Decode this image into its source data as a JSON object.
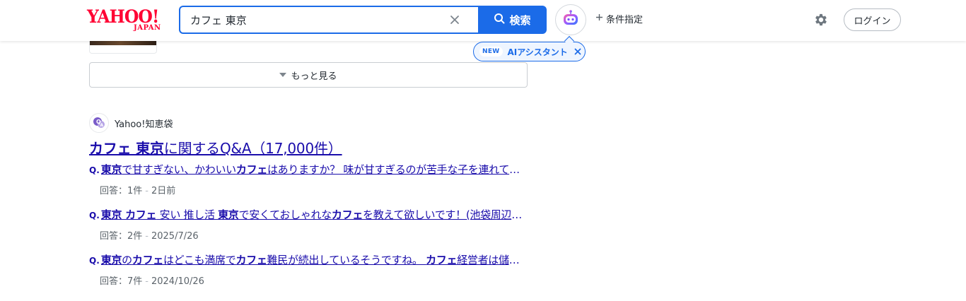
{
  "header": {
    "logo_main": "YAHOO!",
    "logo_sub": "JAPAN",
    "search_value": "カフェ 東京",
    "search_button": "検索",
    "conditions": "条件指定",
    "login": "ログイン"
  },
  "ai_tip": {
    "badge": "NEW",
    "label": "AIアシスタント"
  },
  "more": {
    "label": "もっと見る"
  },
  "chiebukuro": {
    "source": "Yahoo!知恵袋",
    "title_keyword": "カフェ 東京",
    "title_rest": "に関するQ&A（17,000件）",
    "q_marker": "Q.",
    "questions": [
      {
        "parts": [
          {
            "t": "東京",
            "b": true
          },
          {
            "t": "で甘すぎない、かわいい",
            "b": false
          },
          {
            "t": "カフェ",
            "b": true
          },
          {
            "t": "はありますか？ 味が甘すぎるのが苦手な子を連れて行きたいです",
            "b": false
          }
        ],
        "answers": "回答：1件",
        "date": "2日前"
      },
      {
        "parts": [
          {
            "t": "東京 カフェ",
            "b": true
          },
          {
            "t": " 安い 推し活 ",
            "b": false
          },
          {
            "t": "東京",
            "b": true
          },
          {
            "t": "で安くておしゃれな",
            "b": false
          },
          {
            "t": "カフェ",
            "b": true
          },
          {
            "t": "を教えて欲しいです！(池袋周辺でお願いします)",
            "b": false
          }
        ],
        "answers": "回答：2件",
        "date": "2025/7/26"
      },
      {
        "parts": [
          {
            "t": "東京",
            "b": true
          },
          {
            "t": "の",
            "b": false
          },
          {
            "t": "カフェ",
            "b": true
          },
          {
            "t": "はどこも満席で",
            "b": false
          },
          {
            "t": "カフェ",
            "b": true
          },
          {
            "t": "難民が続出しているそうですね。 ",
            "b": false
          },
          {
            "t": "カフェ",
            "b": true
          },
          {
            "t": "経営者は儲かっているのでしょうか",
            "b": false
          }
        ],
        "answers": "回答：7件",
        "date": "2024/10/26"
      }
    ]
  },
  "colors": {
    "brand_red": "#ff0033",
    "accent_blue": "#1b6be8",
    "link_blue": "#1a0dab",
    "meta_gray": "#5b636a"
  },
  "icons": {
    "clear": "close-icon",
    "search": "search-icon",
    "ai": "ai-robot-icon",
    "plus": "plus-icon",
    "settings": "gear-icon",
    "more": "caret-down-icon",
    "source": "chiebukuro-icon"
  }
}
